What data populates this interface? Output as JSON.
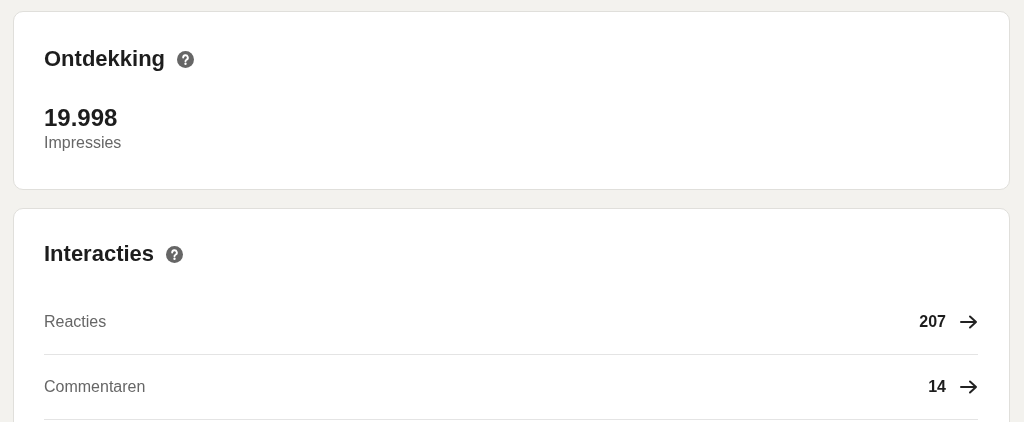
{
  "discovery": {
    "title": "Ontdekking",
    "value": "19.998",
    "label": "Impressies"
  },
  "interactions": {
    "title": "Interacties",
    "rows": [
      {
        "label": "Reacties",
        "value": "207"
      },
      {
        "label": "Commentaren",
        "value": "14"
      }
    ]
  }
}
